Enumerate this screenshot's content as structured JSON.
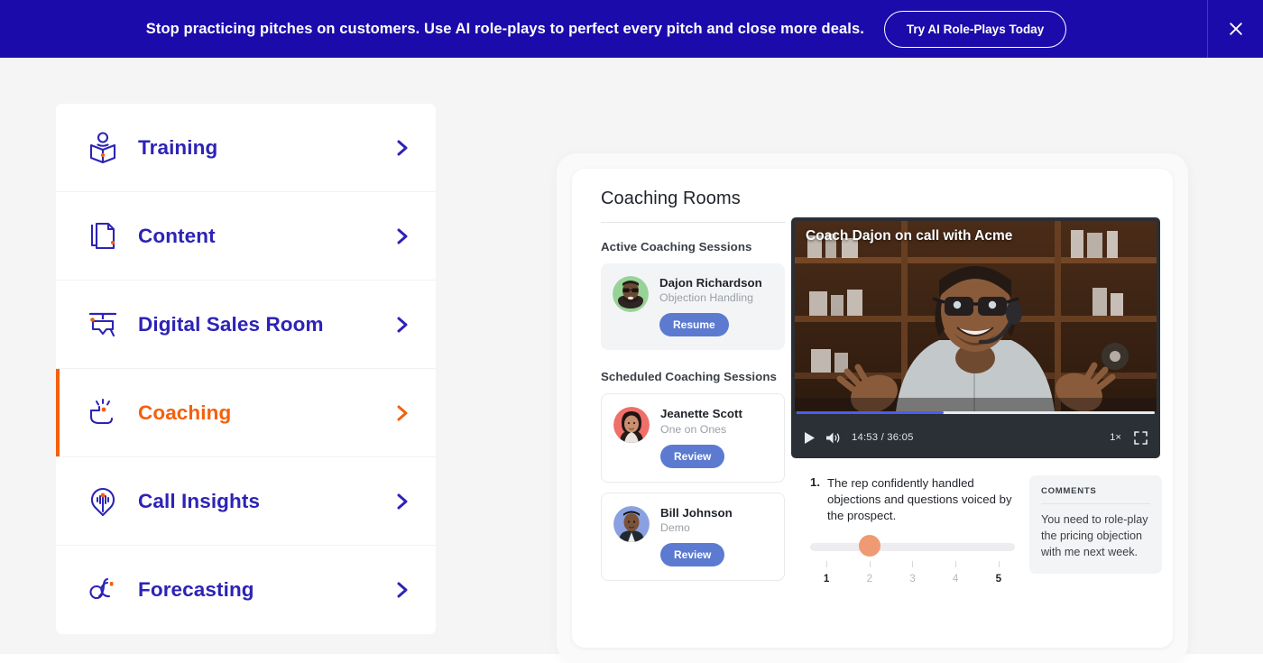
{
  "banner": {
    "text": "Stop practicing pitches on customers. Use AI role-plays to perfect every pitch and close more deals.",
    "cta_label": "Try AI Role-Plays Today",
    "close_icon": "close-icon",
    "background_color": "#1c0bab",
    "text_color": "#ffffff"
  },
  "nav": {
    "accent_color": "#2d23b6",
    "active_color": "#f4600c",
    "items": [
      {
        "label": "Training",
        "icon": "person-book-icon",
        "chevron": "chevron-right-icon",
        "active": false
      },
      {
        "label": "Content",
        "icon": "documents-icon",
        "chevron": "chevron-right-icon",
        "active": false
      },
      {
        "label": "Digital Sales Room",
        "icon": "presentation-screen-icon",
        "chevron": "chevron-right-icon",
        "active": false
      },
      {
        "label": "Coaching",
        "icon": "coaching-hand-icon",
        "chevron": "chevron-right-icon",
        "active": true
      },
      {
        "label": "Call Insights",
        "icon": "location-pin-waveform-icon",
        "chevron": "chevron-right-icon",
        "active": false
      },
      {
        "label": "Forecasting",
        "icon": "forecast-icon",
        "chevron": "chevron-right-icon",
        "active": false
      }
    ]
  },
  "panel": {
    "title": "Coaching Rooms",
    "active_sessions": {
      "heading": "Active Coaching Sessions",
      "items": [
        {
          "name": "Dajon Richardson",
          "topic": "Objection Handling",
          "button_label": "Resume",
          "avatar": "avatar-dajon-richardson",
          "avatar_bg": "#97d396"
        }
      ]
    },
    "scheduled_sessions": {
      "heading": "Scheduled Coaching Sessions",
      "items": [
        {
          "name": "Jeanette Scott",
          "topic": "One on Ones",
          "button_label": "Review",
          "avatar": "avatar-jeanette-scott",
          "avatar_bg": "#ef6f6a"
        },
        {
          "name": "Bill Johnson",
          "topic": "Demo",
          "button_label": "Review",
          "avatar": "avatar-bill-johnson",
          "avatar_bg": "#8aa0e0"
        }
      ]
    },
    "video": {
      "caption": "Coach Dajon on call with Acme",
      "current_time": "14:53",
      "total_time": "36:05",
      "time_display": "14:53 / 36:05",
      "progress_percent": 41,
      "play_icon": "play-icon",
      "volume_icon": "volume-icon",
      "speed_label": "1×",
      "fullscreen_icon": "fullscreen-icon",
      "progress_color": "#4a5ee8"
    },
    "scorecard": {
      "question_number": "1.",
      "question_text": "The rep confidently handled objections and questions voiced by the prospect.",
      "slider": {
        "value": 2,
        "min": 1,
        "max": 5,
        "thumb_color": "#ef9a72",
        "labels": [
          "1",
          "2",
          "3",
          "4",
          "5"
        ]
      }
    },
    "comments": {
      "heading": "COMMENTS",
      "body": "You need to role-play the pricing objection with me next week."
    }
  }
}
